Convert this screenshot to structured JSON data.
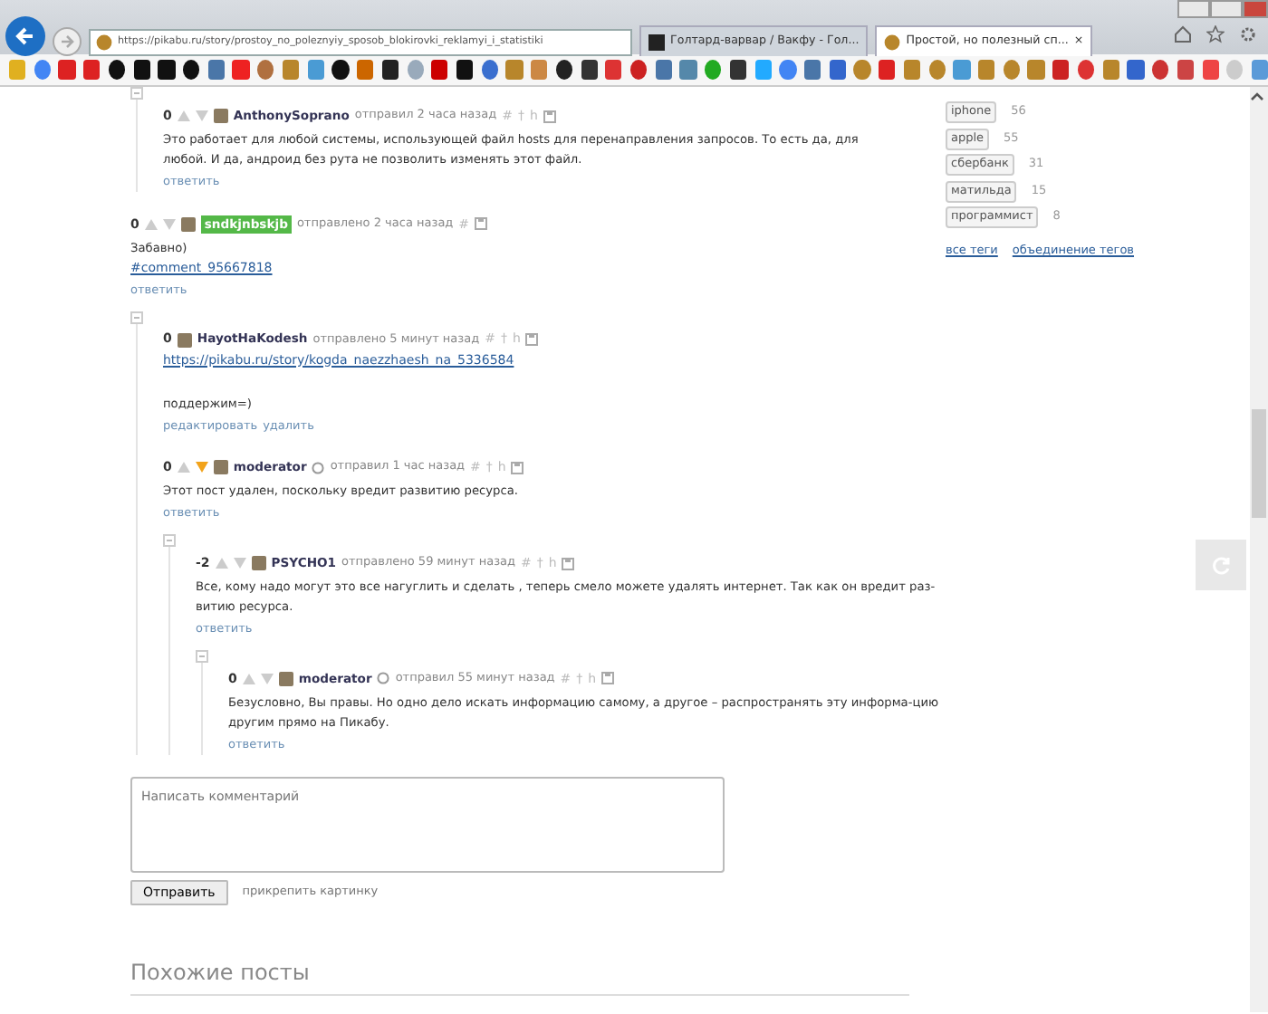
{
  "browser": {
    "url": "https://pikabu.ru/story/prostoy_no_poleznyiy_sposob_blokirovki_reklamyi_i_statistiki",
    "tabs": [
      {
        "title": "Голтард-варвар / Вакфу - Гол...",
        "selected": false
      },
      {
        "title": "Простой, но полезный сп...",
        "selected": true
      }
    ],
    "close_glyph": "×"
  },
  "continued_thread": {
    "children": [
      {
        "rating": "0",
        "own": false,
        "downvoted": false,
        "user": "AnthonySoprano",
        "highlighted": false,
        "moderator": false,
        "posted": "отправил 2 часа назад",
        "tools": [
          "#",
          "†",
          "h"
        ],
        "body": [
          {
            "kind": "text",
            "text": "Это работает для любой системы, использующей файл hosts для перенаправления запросов. То есть да, для любой. И да, андроид без рута не позволить изменять этот файл."
          }
        ],
        "actions": [
          "ответить"
        ]
      }
    ]
  },
  "comments": [
    {
      "rating": "0",
      "own": false,
      "downvoted": false,
      "user": "sndkjnbskjb",
      "highlighted": true,
      "moderator": false,
      "posted": "отправлено 2 часа назад",
      "tools": [
        "#"
      ],
      "body": [
        {
          "kind": "text",
          "text": "Забавно)"
        },
        {
          "kind": "link",
          "text": "#comment_95667818"
        }
      ],
      "actions": [
        "ответить"
      ],
      "children": [
        {
          "rating": "0",
          "own": true,
          "user": "HayotHaKodesh",
          "highlighted": false,
          "moderator": false,
          "posted": "отправлено 5 минут назад",
          "tools": [
            "#",
            "†",
            "h"
          ],
          "body": [
            {
              "kind": "link",
              "text": "https://pikabu.ru/story/kogda_naezzhaesh_na_5336584"
            },
            {
              "kind": "gap"
            },
            {
              "kind": "text",
              "text": "поддержим=)"
            }
          ],
          "actions": [
            "редактировать",
            "удалить"
          ]
        },
        {
          "rating": "0",
          "own": false,
          "downvoted": true,
          "user": "moderator",
          "highlighted": false,
          "moderator": true,
          "posted": "отправил 1 час назад",
          "tools": [
            "#",
            "†",
            "h"
          ],
          "body": [
            {
              "kind": "text",
              "text": "Этот пост удален, поскольку вредит развитию ресурса."
            }
          ],
          "actions": [
            "ответить"
          ],
          "children": [
            {
              "rating": "-2",
              "own": false,
              "downvoted": false,
              "user": "PSYCHO1",
              "highlighted": false,
              "moderator": false,
              "posted": "отправлено 59 минут назад",
              "tools": [
                "#",
                "†",
                "h"
              ],
              "body": [
                {
                  "kind": "text",
                  "text": "Все, кому надо могут это все нагуглить и сделать , теперь смело можете удалять интернет. Так как он вредит раз-витию ресурса."
                }
              ],
              "actions": [
                "ответить"
              ],
              "children": [
                {
                  "rating": "0",
                  "own": false,
                  "downvoted": false,
                  "user": "moderator",
                  "highlighted": false,
                  "moderator": true,
                  "posted": "отправил 55 минут назад",
                  "tools": [
                    "#",
                    "†",
                    "h"
                  ],
                  "body": [
                    {
                      "kind": "text",
                      "text": "Безусловно, Вы правы. Но одно дело искать информацию самому, а другое – распространять эту информа-цию другим прямо на Пикабу."
                    }
                  ],
                  "actions": [
                    "ответить"
                  ]
                }
              ]
            }
          ]
        }
      ]
    }
  ],
  "comment_form": {
    "placeholder": "Написать комментарий",
    "submit": "Отправить",
    "attach": "прикрепить картинку"
  },
  "similar_posts": {
    "title": "Похожие посты"
  },
  "sidebar": {
    "tags": [
      {
        "name": "iphone",
        "count": "56"
      },
      {
        "name": "apple",
        "count": "55"
      },
      {
        "name": "сбербанк",
        "count": "31"
      },
      {
        "name": "матильда",
        "count": "15"
      },
      {
        "name": "программист",
        "count": "8"
      }
    ],
    "links": [
      "все теги",
      "объединение тегов"
    ]
  }
}
